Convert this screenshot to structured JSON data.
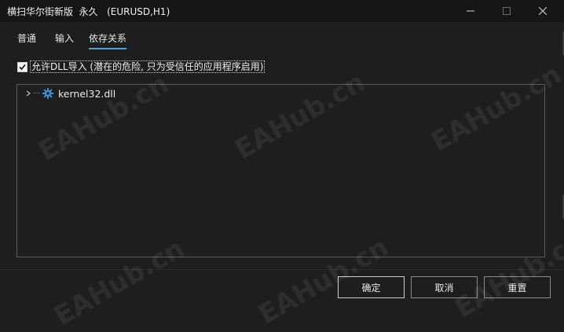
{
  "window": {
    "title": "横扫华尔街新版  永久   (EURUSD,H1)",
    "minimize_icon": "minimize-icon",
    "maximize_icon": "maximize-icon",
    "close_icon": "close-icon"
  },
  "tabs": [
    {
      "label": "普通",
      "active": false
    },
    {
      "label": "输入",
      "active": false
    },
    {
      "label": "依存关系",
      "active": true
    }
  ],
  "options": {
    "allow_dll": {
      "label": "允许DLL导入 (潜在的危险, 只为受信任的应用程序启用)",
      "checked": true
    }
  },
  "dependencies": {
    "items": [
      {
        "label": "kernel32.dll",
        "icon": "gear-icon",
        "expanded": false
      }
    ]
  },
  "buttons": {
    "ok": "确定",
    "cancel": "取消",
    "reset": "重置"
  },
  "watermark": {
    "text": "EAHub.cn"
  },
  "colors": {
    "background": "#1e1e1e",
    "titlebar": "#151515",
    "tab_underline": "#4aa3df",
    "gear_icon": "#3d8fd6"
  }
}
